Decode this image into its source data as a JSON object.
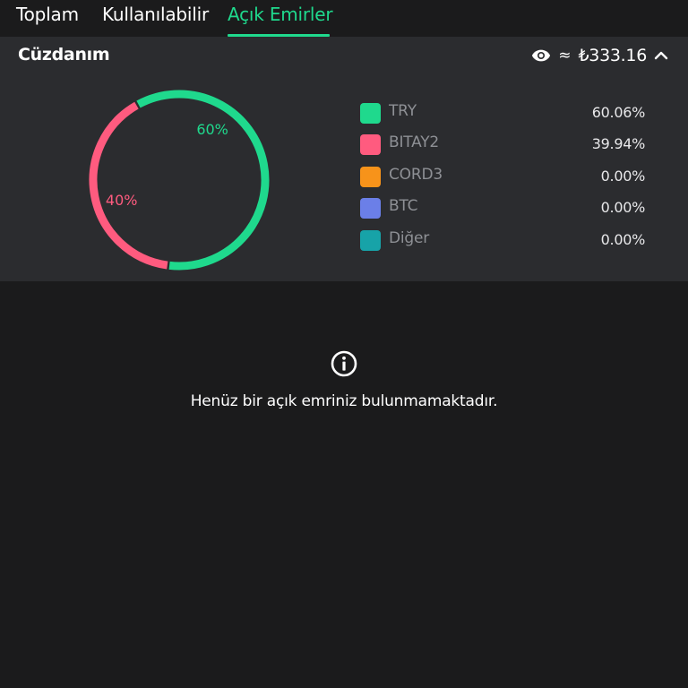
{
  "tabs": [
    {
      "label": "Toplam",
      "active": false
    },
    {
      "label": "Kullanılabilir",
      "active": false
    },
    {
      "label": "Açık Emirler",
      "active": true
    }
  ],
  "wallet": {
    "title": "Cüzdanım",
    "approx_symbol": "≈",
    "balance": "₺333.16",
    "icons": [
      "eye-icon",
      "chevron-up-icon"
    ]
  },
  "chart_data": {
    "type": "pie",
    "categories": [
      "TRY",
      "BITAY2",
      "CORD3",
      "BTC",
      "Diğer"
    ],
    "values": [
      60.06,
      39.94,
      0.0,
      0.0,
      0.0
    ],
    "value_labels": [
      "60.06%",
      "39.94%",
      "0.00%",
      "0.00%",
      "0.00%"
    ],
    "slice_labels": [
      "60%",
      "40%"
    ],
    "colors": [
      "#1fd98d",
      "#ff5b7f",
      "#f7931a",
      "#6b7fe8",
      "#17a3a8"
    ],
    "legend_position": "right",
    "title": "",
    "donut": true
  },
  "empty_state": {
    "icon": "info-icon",
    "message": "Henüz bir açık emriniz bulunmamaktadır."
  },
  "colors": {
    "accent": "#1fd98d",
    "background": "#1b1b1c",
    "card": "#2b2c2f"
  }
}
